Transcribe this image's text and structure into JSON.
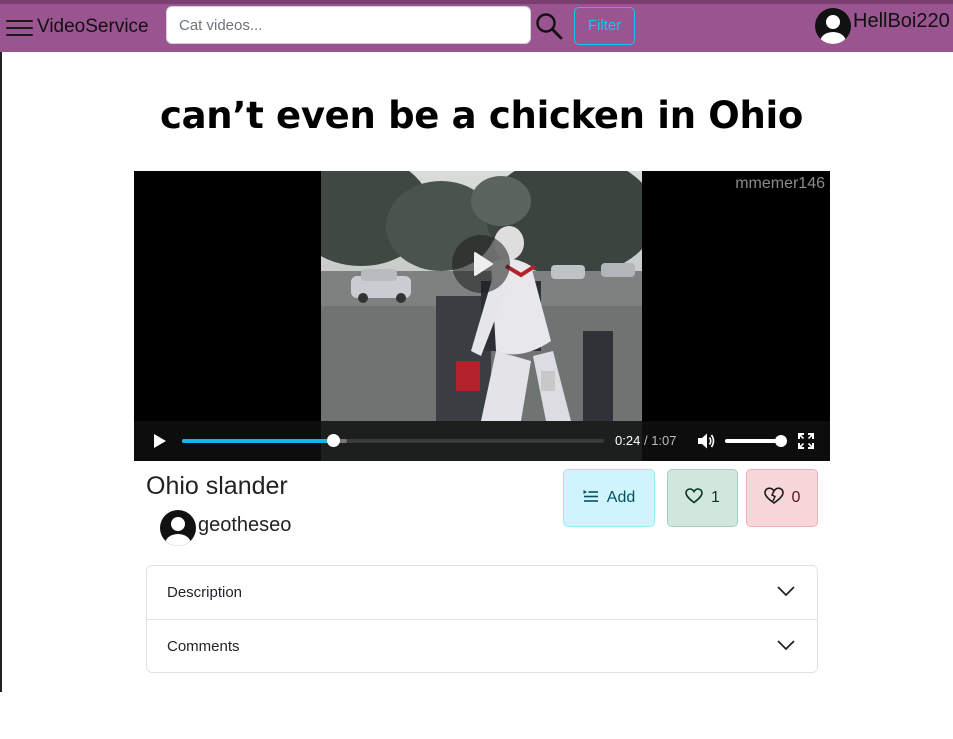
{
  "app": {
    "brand": "VideoService"
  },
  "search": {
    "placeholder": "Cat videos...",
    "value": ""
  },
  "header": {
    "filter_label": "Filter",
    "username": "HellBoi220"
  },
  "video": {
    "title": "can’t even be a chicken in Ohio",
    "watermark": "mmemer146",
    "current_time": "0:24",
    "time_separator": "/",
    "duration": "1:07",
    "progress_fraction": 0.358,
    "buffered_fraction": 0.39,
    "volume_fraction": 1.0
  },
  "info": {
    "name": "Ohio slander",
    "channel": "geotheseo"
  },
  "actions": {
    "add_label": "Add",
    "like_count": "1",
    "dislike_count": "0"
  },
  "accordion": {
    "items": [
      {
        "label": "Description"
      },
      {
        "label": "Comments"
      }
    ]
  },
  "colors": {
    "navbar": "#9a5590",
    "filter_accent": "#0dcaf0",
    "seek_played": "#1ab2e8",
    "add_bg": "#cff4fc",
    "like_bg": "#d1e7dd",
    "dislike_bg": "#f8d7da"
  },
  "icons": {
    "menu": "hamburger-icon",
    "search": "search-icon",
    "avatar": "user-avatar-icon",
    "play": "play-icon",
    "volume": "volume-icon",
    "fullscreen": "fullscreen-icon",
    "playlist_add": "playlist-add-icon",
    "like": "heart-icon",
    "dislike": "heartbreak-icon",
    "chevron": "chevron-down-icon"
  }
}
